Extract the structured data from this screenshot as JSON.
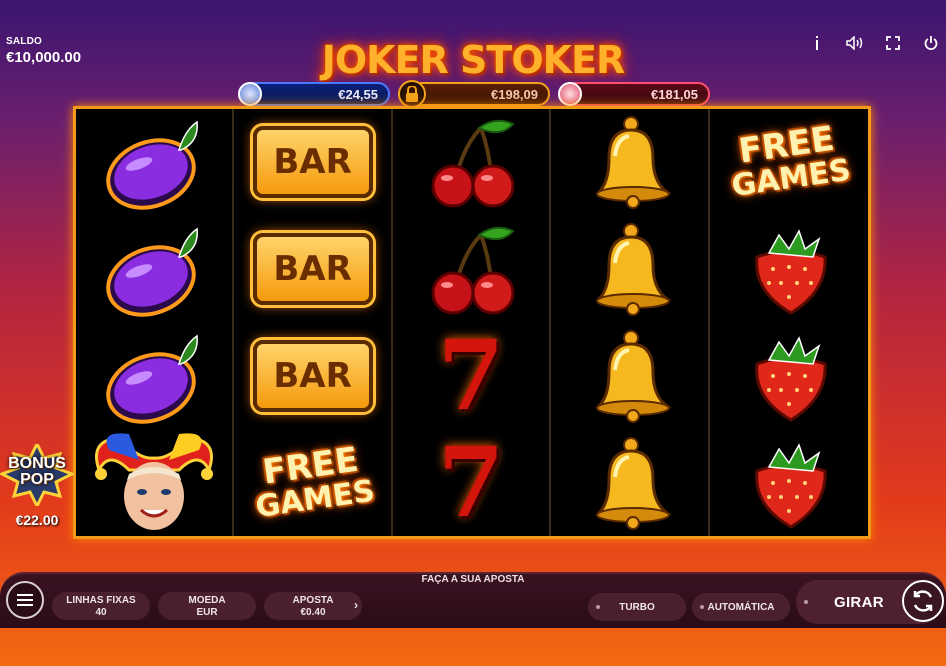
{
  "balance": {
    "label": "SALDO",
    "value": "€10,000.00"
  },
  "top_icons": [
    "info-icon",
    "sound-icon",
    "fullscreen-icon",
    "power-icon"
  ],
  "title": "JOKER STOKER",
  "jackpots": [
    {
      "value": "€24,55",
      "tier": "blue"
    },
    {
      "value": "€198,09",
      "tier": "gold",
      "locked": true
    },
    {
      "value": "€181,05",
      "tier": "red"
    }
  ],
  "reels": [
    [
      "plum",
      "plum",
      "plum",
      "joker"
    ],
    [
      "bar",
      "bar",
      "bar",
      "free-games"
    ],
    [
      "cherry",
      "cherry",
      "seven",
      "seven"
    ],
    [
      "bell",
      "bell",
      "bell",
      "bell"
    ],
    [
      "free-games",
      "strawberry",
      "strawberry",
      "strawberry"
    ]
  ],
  "symbol_text": {
    "bar": "BAR",
    "free_line1": "FREE",
    "free_line2": "GAMES",
    "seven": "7"
  },
  "bonus": {
    "title_line1": "BONUS",
    "title_line2": "POP",
    "value": "€22.00"
  },
  "footer": {
    "bet_prompt": "FAÇA A SUA APOSTA",
    "lines_label": "LINHAS FIXAS",
    "lines_value": "40",
    "coin_label": "MOEDA",
    "coin_value": "EUR",
    "bet_label": "APOSTA",
    "bet_value": "€0.40",
    "turbo_label": "TURBO",
    "auto_label": "AUTOMÁTICA",
    "spin_label": "GIRAR"
  },
  "colors": {
    "frame": "#f39a1a",
    "reel_bg": "#000000",
    "bar_bg": "#2a0c18"
  }
}
